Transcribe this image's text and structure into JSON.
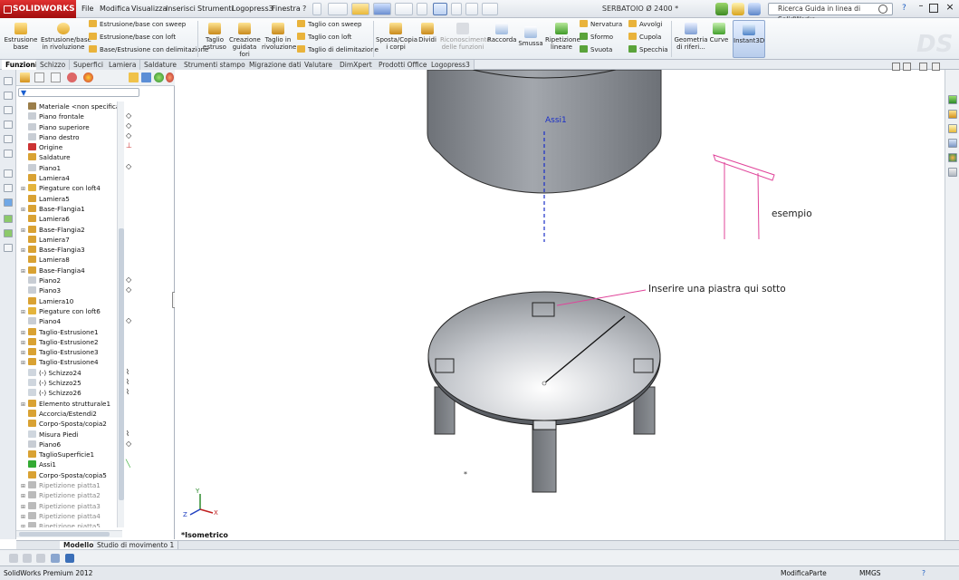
{
  "app": {
    "brand": "SOLIDWORKS",
    "document_title": "SERBATOIO Ø 2400 *",
    "search_placeholder": "Ricerca Guida in linea di SolidWorks",
    "help_label": "?"
  },
  "menus": [
    "File",
    "Modifica",
    "Visualizza",
    "Inserisci",
    "Strumenti",
    "Logopress3",
    "Finestra"
  ],
  "ribbon": {
    "estrusione_base": "Estrusione base",
    "estrusione_rivoluzione": "Estrusione/base in rivoluzione",
    "small1": [
      "Estrusione/base con sweep",
      "Estrusione/base con loft",
      "Base/Estrusione con delimitazione"
    ],
    "taglio_estruso": "Taglio estruso",
    "creazione_fori": "Creazione guidata fori",
    "taglio_rivoluzione": "Taglio in rivoluzione",
    "small2": [
      "Taglio con sweep",
      "Taglio con loft",
      "Taglio di delimitazione"
    ],
    "sposta_copia": "Sposta/Copia i corpi",
    "dividi": "Dividi",
    "riconoscimento": "Riconoscimento delle funzioni",
    "raccorda": "Raccorda",
    "smussa": "Smussa",
    "ripetizione_lineare": "Ripetizione lineare",
    "small3": [
      "Nervatura",
      "Sformo",
      "Svuota"
    ],
    "small4": [
      "Avvolgi",
      "Cupola",
      "Specchia"
    ],
    "geometria": "Geometria di riferi...",
    "curve": "Curve",
    "instant3d": "Instant3D"
  },
  "tabs": [
    "Funzioni",
    "Schizzo",
    "Superfici",
    "Lamiera",
    "Saldature",
    "Strumenti stampo",
    "Migrazione dati",
    "Valutare",
    "DimXpert",
    "Prodotti Office",
    "Logopress3"
  ],
  "active_tab": "Funzioni",
  "tree": [
    {
      "label": "Materiale <non specificato>",
      "icon": "material"
    },
    {
      "label": "Piano frontale",
      "icon": "plane"
    },
    {
      "label": "Piano superiore",
      "icon": "plane"
    },
    {
      "label": "Piano destro",
      "icon": "plane"
    },
    {
      "label": "Origine",
      "icon": "origin"
    },
    {
      "label": "Saldature",
      "icon": "weldment"
    },
    {
      "label": "Piano1",
      "icon": "plane"
    },
    {
      "label": "Lamiera4",
      "icon": "sheetmetal"
    },
    {
      "label": "Piegature con loft4",
      "icon": "loft",
      "exp": true
    },
    {
      "label": "Lamiera5",
      "icon": "sheetmetal"
    },
    {
      "label": "Base-Flangia1",
      "icon": "flange",
      "exp": true
    },
    {
      "label": "Lamiera6",
      "icon": "sheetmetal"
    },
    {
      "label": "Base-Flangia2",
      "icon": "flange",
      "exp": true
    },
    {
      "label": "Lamiera7",
      "icon": "sheetmetal"
    },
    {
      "label": "Base-Flangia3",
      "icon": "flange",
      "exp": true
    },
    {
      "label": "Lamiera8",
      "icon": "sheetmetal"
    },
    {
      "label": "Base-Flangia4",
      "icon": "flange",
      "exp": true
    },
    {
      "label": "Piano2",
      "icon": "plane"
    },
    {
      "label": "Piano3",
      "icon": "plane"
    },
    {
      "label": "Lamiera10",
      "icon": "sheetmetal"
    },
    {
      "label": "Piegature con loft6",
      "icon": "loft",
      "exp": true
    },
    {
      "label": "Piano4",
      "icon": "plane"
    },
    {
      "label": "Taglio-Estrusione1",
      "icon": "cut",
      "exp": true
    },
    {
      "label": "Taglio-Estrusione2",
      "icon": "cut",
      "exp": true
    },
    {
      "label": "Taglio-Estrusione3",
      "icon": "cut",
      "exp": true
    },
    {
      "label": "Taglio-Estrusione4",
      "icon": "cut",
      "exp": true
    },
    {
      "label": "(-) Schizzo24",
      "icon": "sketch"
    },
    {
      "label": "(-) Schizzo25",
      "icon": "sketch"
    },
    {
      "label": "(-) Schizzo26",
      "icon": "sketch"
    },
    {
      "label": "Elemento strutturale1",
      "icon": "structural",
      "exp": true
    },
    {
      "label": "Accorcia/Estendi2",
      "icon": "trim"
    },
    {
      "label": "Corpo-Sposta/copia2",
      "icon": "move"
    },
    {
      "label": "Misura Piedi",
      "icon": "sketch"
    },
    {
      "label": "Piano6",
      "icon": "plane"
    },
    {
      "label": "TaglioSuperficie1",
      "icon": "cut"
    },
    {
      "label": "Assi1",
      "icon": "axis"
    },
    {
      "label": "Corpo-Sposta/copia5",
      "icon": "move"
    },
    {
      "label": "Ripetizione piatta1",
      "icon": "pattern",
      "exp": true,
      "grey": true
    },
    {
      "label": "Ripetizione piatta2",
      "icon": "pattern",
      "exp": true,
      "grey": true
    },
    {
      "label": "Ripetizione piatta3",
      "icon": "pattern",
      "exp": true,
      "grey": true
    },
    {
      "label": "Ripetizione piatta4",
      "icon": "pattern",
      "exp": true,
      "grey": true
    },
    {
      "label": "Ripetizione piatta5",
      "icon": "pattern",
      "exp": true,
      "grey": true
    }
  ],
  "viewport": {
    "axis_label": "Assi1",
    "annotation_piastra": "Inserire una piastra qui sotto",
    "annotation_esempio": "esempio",
    "view_name": "*Isometrico",
    "triad": {
      "x": "X",
      "y": "Y",
      "z": "Z"
    }
  },
  "bottom_tabs": [
    "Modello",
    "Studio di movimento 1"
  ],
  "status": {
    "product": "SolidWorks Premium 2012",
    "mode": "ModificaParte",
    "units": "MMGS",
    "help": "?"
  },
  "colors": {
    "accent": "#2a6fd6",
    "brand_red": "#c41a1a",
    "annotation": "#e0449a",
    "axis_blue": "#1a2fc8",
    "model_grey": "#8c9096"
  }
}
